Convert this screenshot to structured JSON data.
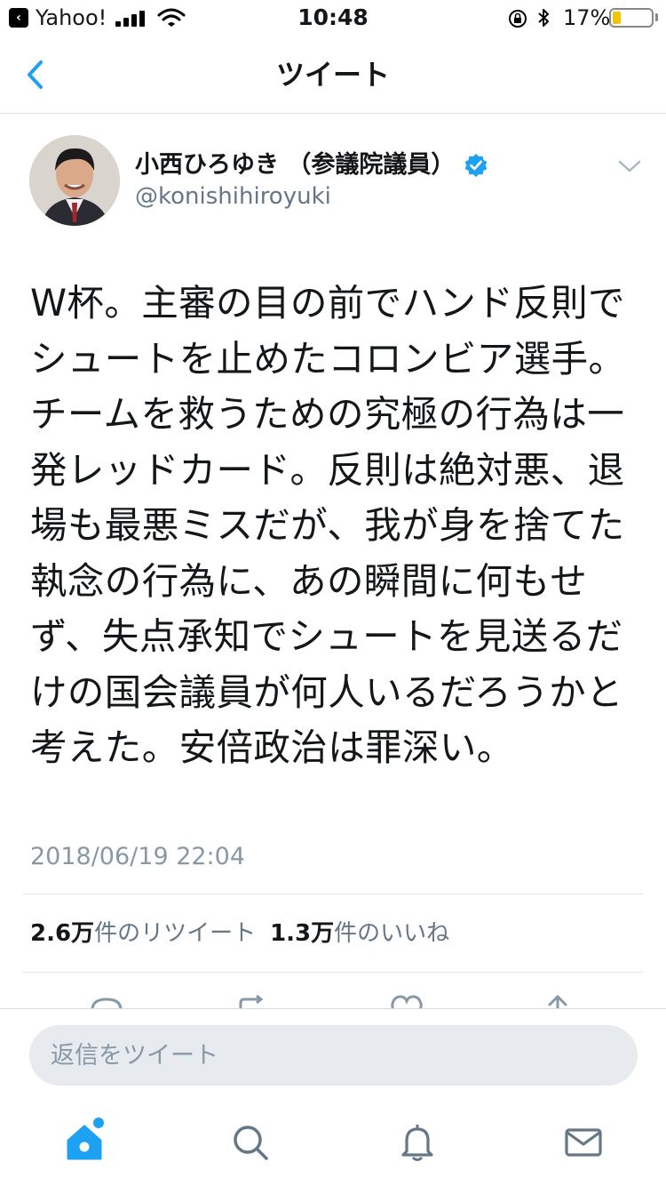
{
  "status_bar": {
    "back_app": "Yahoo!",
    "time": "10:48",
    "battery_percent": "17%",
    "battery_level": 0.17,
    "icons": [
      "back-icon",
      "signal-icon",
      "wifi-icon",
      "rotation-lock-icon",
      "bluetooth-icon",
      "battery-icon"
    ]
  },
  "nav": {
    "title": "ツイート"
  },
  "tweet": {
    "author_name": "小西ひろゆき （参議院議員）",
    "author_handle": "@konishihiroyuki",
    "verified": true,
    "text": "W杯。主審の目の前でハンド反則でシュートを止めたコロンビア選手。チームを救うための究極の行為は一発レッドカード。反則は絶対悪、退場も最悪ミスだが、我が身を捨てた執念の行為に、あの瞬間に何もせず、失点承知でシュートを見送るだけの国会議員が何人いるだろうかと考えた。安倍政治は罪深い。",
    "timestamp": "2018/06/19 22:04",
    "retweet_count": "2.6万",
    "retweet_label": "件のリツイート",
    "like_count": "1.3万",
    "like_label": "件のいいね"
  },
  "compose": {
    "placeholder": "返信をツイート"
  },
  "tabbar": {
    "items": [
      "home-icon",
      "search-icon",
      "notifications-icon",
      "messages-icon"
    ]
  },
  "colors": {
    "accent": "#1da1f2",
    "text": "#14171a",
    "secondary": "#657786",
    "divider": "#e1e8ed",
    "input_bg": "#e7ebef"
  }
}
